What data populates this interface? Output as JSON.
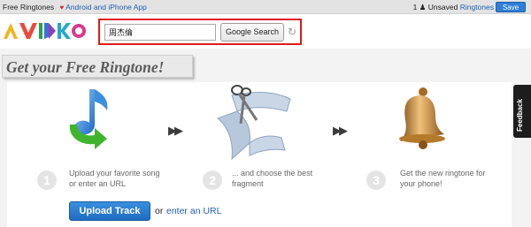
{
  "topbar": {
    "left_label": "Free Ringtones",
    "heart_icon": "heart-icon",
    "app_link": "Android and iPhone App",
    "unsaved_count": "1",
    "unsaved_label": "Unsaved",
    "person_icon": "person-icon",
    "ringtones_link": "Ringtones",
    "save_label": "Save"
  },
  "header": {
    "logo_text": "AUDIKO",
    "search_value": "周杰倫",
    "search_button": "Google Search",
    "spinner_icon": "refresh-icon",
    "highlight_color": "#e01a1a"
  },
  "banner": {
    "title": "Get your Free Ringtone!"
  },
  "steps": [
    {
      "number": "1",
      "text_line1": "Upload your favorite song",
      "text_line2": "or enter an URL",
      "icon": "music-note-upload-icon"
    },
    {
      "number": "2",
      "text_line1": "... and choose the best",
      "text_line2": "fragment",
      "icon": "scissors-wave-icon"
    },
    {
      "number": "3",
      "text_line1": "Get the new ringtone for",
      "text_line2": "your phone!",
      "icon": "bell-icon"
    }
  ],
  "actions": {
    "upload_button": "Upload Track",
    "or_text": "or",
    "enter_url_link": "enter an URL"
  },
  "feedback": {
    "label": "Feedback"
  },
  "colors": {
    "accent_blue": "#2f7fd8",
    "link_blue": "#1f5fb3"
  }
}
